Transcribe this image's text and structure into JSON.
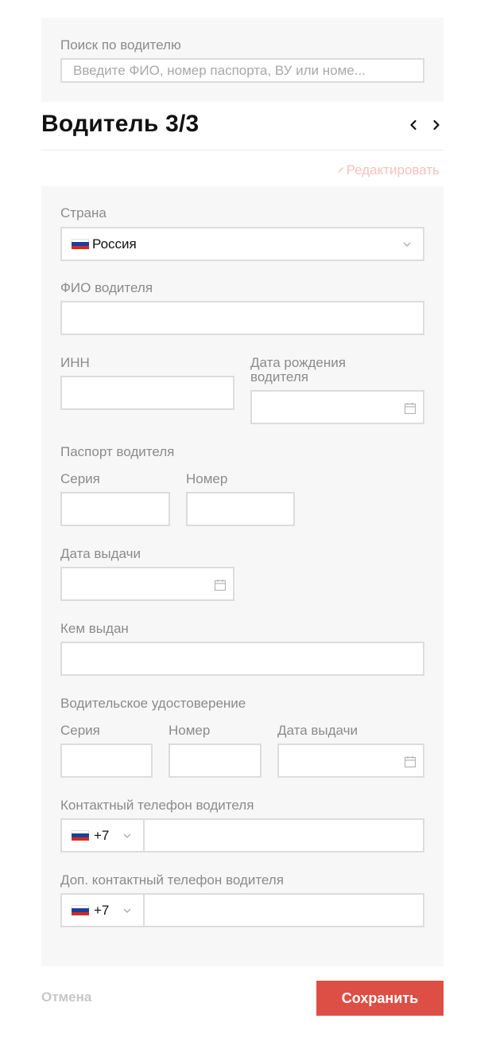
{
  "search": {
    "label": "Поиск по водителю",
    "placeholder": "Введите ФИО, номер паспорта, ВУ или номе..."
  },
  "header": {
    "title": "Водитель 3/3",
    "edit_label": "Редактировать"
  },
  "form": {
    "country": {
      "label": "Страна",
      "value": "Россия"
    },
    "full_name": {
      "label": "ФИО водителя",
      "value": ""
    },
    "inn": {
      "label": "ИНН",
      "value": ""
    },
    "birth_date": {
      "label_line1": "Дата рождения",
      "label_line2": "водителя",
      "value": ""
    },
    "passport": {
      "section_label": "Паспорт водителя",
      "series_label": "Серия",
      "number_label": "Номер",
      "issue_date_label": "Дата выдачи",
      "issued_by_label": "Кем выдан"
    },
    "license": {
      "section_label": "Водительское удостоверение",
      "series_label": "Серия",
      "number_label": "Номер",
      "issue_date_label": "Дата выдачи"
    },
    "phone": {
      "label": "Контактный телефон водителя",
      "code": "+7",
      "value": ""
    },
    "phone_extra": {
      "label": "Доп. контактный телефон водителя",
      "code": "+7",
      "value": ""
    }
  },
  "actions": {
    "cancel_label": "Отмена",
    "save_label": "Сохранить"
  },
  "colors": {
    "accent": "#dd4f45",
    "edit_link": "#f4c2c0",
    "panel_bg": "#f7f7f7",
    "border": "#dcdcdc"
  },
  "icons": [
    "chevron-left-icon",
    "chevron-right-icon",
    "pencil-icon",
    "russia-flag-icon",
    "chevron-down-icon",
    "calendar-icon"
  ]
}
